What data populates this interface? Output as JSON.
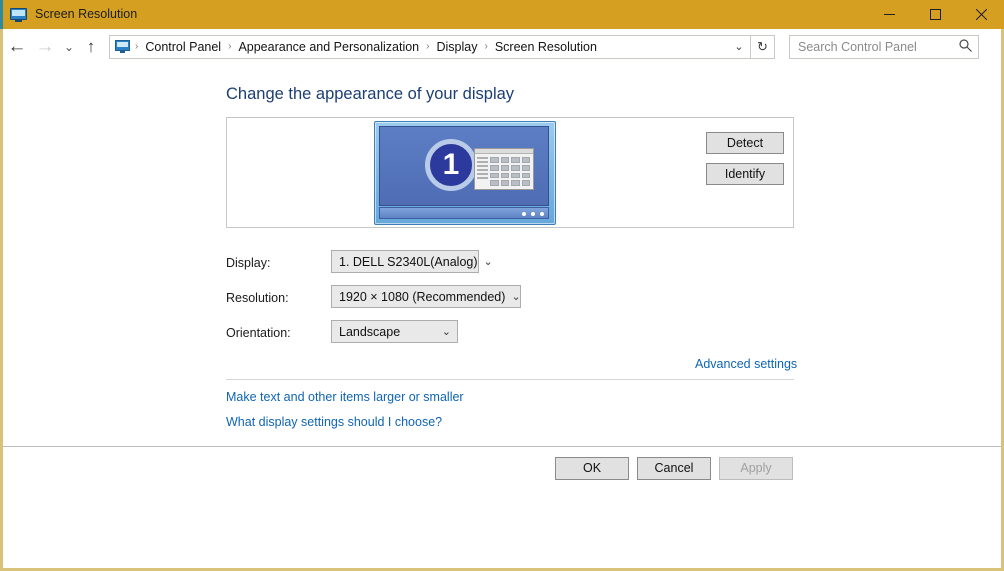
{
  "window": {
    "title": "Screen Resolution",
    "icon": "monitor-icon",
    "controls": {
      "minimize": "—",
      "maximize": "☐",
      "close": "✕"
    },
    "accent_color": "#d5a021",
    "border_color": "#d9c27a"
  },
  "navbar": {
    "back": "←",
    "forward": "→",
    "recent": "⌄",
    "up": "↑",
    "breadcrumb_icon": "control-panel-icon",
    "breadcrumbs": [
      {
        "label": "Control Panel"
      },
      {
        "label": "Appearance and Personalization"
      },
      {
        "label": "Display"
      },
      {
        "label": "Screen Resolution"
      }
    ],
    "separator": "›",
    "dropdown": "⌄",
    "refresh": "↻",
    "search": {
      "placeholder": "Search Control Panel",
      "value": "",
      "icon": "⌕"
    }
  },
  "main": {
    "page_title": "Change the appearance of your display",
    "preview": {
      "monitor_number": "1",
      "taskbar_dots": 3
    },
    "detect_button": "Detect",
    "identify_button": "Identify",
    "fields": [
      {
        "label": "Display:",
        "value": "1. DELL S2340L(Analog)",
        "arrow": "⌄"
      },
      {
        "label": "Resolution:",
        "value": "1920 × 1080 (Recommended)",
        "arrow": "⌄"
      },
      {
        "label": "Orientation:",
        "value": "Landscape",
        "arrow": "⌄"
      }
    ],
    "links": {
      "advanced": "Advanced settings",
      "larger_smaller": "Make text and other items larger or smaller",
      "what_settings": "What display settings should I choose?"
    },
    "link_color": "#0f65b5",
    "title_color": "#1c3e75"
  },
  "footer": {
    "ok": "OK",
    "cancel": "Cancel",
    "apply": "Apply",
    "apply_enabled": false
  }
}
